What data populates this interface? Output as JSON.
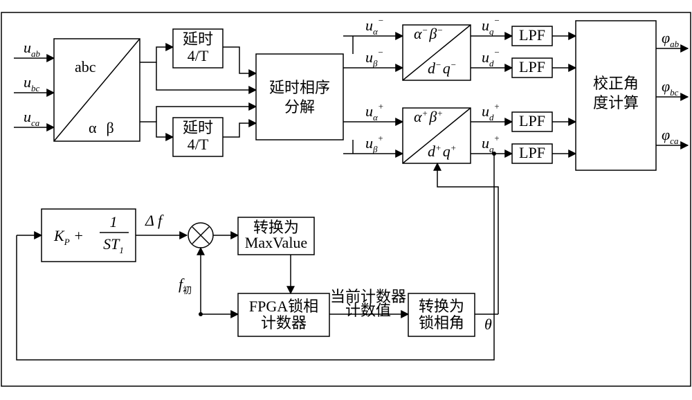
{
  "inputs": {
    "u_ab": "u",
    "u_bc": "u",
    "u_ca": "u",
    "sub_ab": "ab",
    "sub_bc": "bc",
    "sub_ca": "ca"
  },
  "clarke": {
    "top": "abc",
    "bottom_a": "α",
    "bottom_b": "β"
  },
  "delay": {
    "line1": "延时",
    "line2": "4/T"
  },
  "seq": {
    "line1": "延时相序",
    "line2": "分解"
  },
  "sig": {
    "ua_neg": "u",
    "ua_neg_sub": "α",
    "ua_neg_sup": "−",
    "ub_neg": "u",
    "ub_neg_sub": "β",
    "ub_neg_sup": "−",
    "ua_pos": "u",
    "ua_pos_sub": "α",
    "ua_pos_sup": "+",
    "ub_pos": "u",
    "ub_pos_sub": "β",
    "ub_pos_sup": "+",
    "uq_neg": "u",
    "uq_neg_sub": "q",
    "uq_neg_sup": "−",
    "ud_neg": "u",
    "ud_neg_sub": "d",
    "ud_neg_sup": "−",
    "ud_pos": "u",
    "ud_pos_sub": "d",
    "ud_pos_sup": "+",
    "uq_pos": "u",
    "uq_pos_sub": "q",
    "uq_pos_sup": "+"
  },
  "park_neg": {
    "top_a": "α",
    "top_a_sup": "−",
    "top_b": "β",
    "top_b_sup": "−",
    "bot_a": "d",
    "bot_a_sup": "−",
    "bot_b": "q",
    "bot_b_sup": "−"
  },
  "park_pos": {
    "top_a": "α",
    "top_a_sup": "+",
    "top_b": "β",
    "top_b_sup": "+",
    "bot_a": "d",
    "bot_a_sup": "+",
    "bot_b": "q",
    "bot_b_sup": "+"
  },
  "lpf": "LPF",
  "angle": {
    "line1": "校正角",
    "line2": "度计算"
  },
  "outputs": {
    "phi": "φ",
    "ab": "ab",
    "bc": "bc",
    "ca": "ca"
  },
  "pi": {
    "K": "K",
    "P": "P",
    "plus": " + ",
    "one": "1",
    "den_S": "ST",
    "den_1": "1"
  },
  "df_sym": "Δ",
  "df_f": " f",
  "f0_f": "f",
  "f0_sub": "初",
  "maxv": {
    "line1": "转换为",
    "line2": "MaxValue"
  },
  "fpga": {
    "line1": "FPGA锁相",
    "line2": "计数器"
  },
  "cnt": {
    "line1": "当前计数器",
    "line2": "计数值"
  },
  "lock": {
    "line1": "转换为",
    "line2": "锁相角"
  },
  "theta": "θ"
}
